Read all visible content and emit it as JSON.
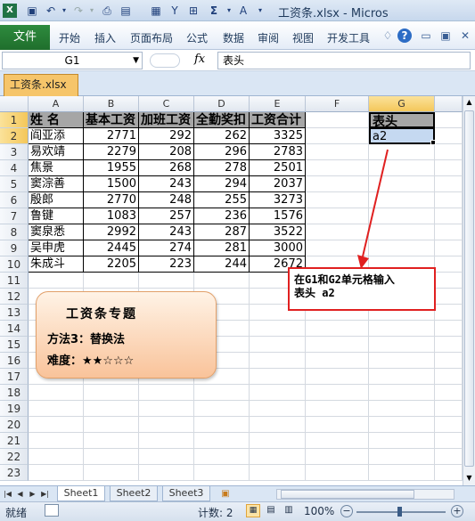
{
  "titlebar": {
    "title": "工资条.xlsx - Micros",
    "icons": [
      "excel-logo-icon",
      "save-icon",
      "undo-icon",
      "redo-icon",
      "print-preview-icon",
      "format-icon",
      "calculator-icon",
      "filter-icon",
      "borders-icon",
      "sum-icon",
      "text-icon",
      "customize-qat-icon"
    ]
  },
  "ribbon": {
    "file_label": "文件",
    "tabs": [
      "开始",
      "插入",
      "页面布局",
      "公式",
      "数据",
      "审阅",
      "视图",
      "开发工具"
    ],
    "help_label": "?"
  },
  "formula_bar": {
    "name_box": "G1",
    "fx_label": "fx",
    "value": "表头"
  },
  "workbook_tab": "工资条.xlsx",
  "grid": {
    "columns": [
      "A",
      "B",
      "C",
      "D",
      "E",
      "F",
      "G"
    ],
    "rows": [
      "1",
      "2",
      "3",
      "4",
      "5",
      "6",
      "7",
      "8",
      "9",
      "10",
      "11",
      "12",
      "13",
      "14",
      "15",
      "16",
      "17",
      "18",
      "19",
      "20",
      "21",
      "22",
      "23"
    ],
    "headers": [
      "姓  名",
      "基本工资",
      "加班工资",
      "全勤奖扣",
      "工资合计"
    ],
    "data": [
      [
        "阎亚添",
        "2771",
        "292",
        "262",
        "3325"
      ],
      [
        "易欢靖",
        "2279",
        "208",
        "296",
        "2783"
      ],
      [
        "焦景",
        "1955",
        "268",
        "278",
        "2501"
      ],
      [
        "窦淙善",
        "1500",
        "243",
        "294",
        "2037"
      ],
      [
        "殷郎",
        "2770",
        "248",
        "255",
        "3273"
      ],
      [
        "鲁键",
        "1083",
        "257",
        "236",
        "1576"
      ],
      [
        "窦泉悉",
        "2992",
        "243",
        "287",
        "3522"
      ],
      [
        "吴申虎",
        "2445",
        "274",
        "281",
        "3000"
      ],
      [
        "朱成斗",
        "2205",
        "223",
        "244",
        "2672"
      ]
    ],
    "g1": "表头",
    "g2": "a2"
  },
  "card": {
    "title": "工资条专题",
    "method": "方法3：替换法",
    "difficulty": "难度：★★☆☆☆"
  },
  "callout": {
    "line1": "在G1和G2单元格输入",
    "line2": "表头  a2"
  },
  "sheets": [
    "Sheet1",
    "Sheet2",
    "Sheet3"
  ],
  "status": {
    "ready": "就绪",
    "count": "计数: 2",
    "zoom": "100%"
  },
  "colors": {
    "accent_green": "#1f6f2c",
    "callout_red": "#e02020",
    "header_gray": "#a6a6a6",
    "selection_blue": "#c5d9f1"
  }
}
